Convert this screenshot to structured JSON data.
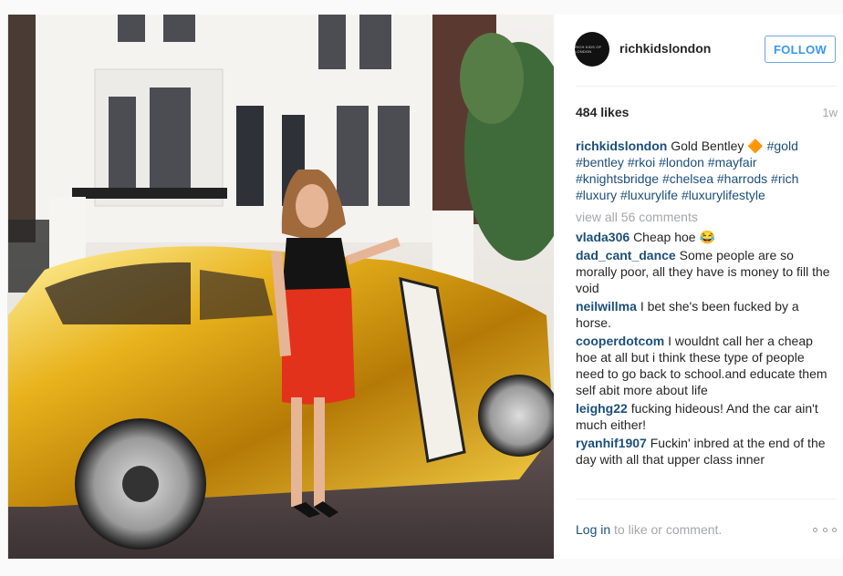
{
  "post": {
    "username": "richkidslondon",
    "avatar_text": "RICH KIDS OF LONDON",
    "follow_label": "FOLLOW",
    "likes": "484 likes",
    "time": "1w",
    "caption": {
      "username": "richkidslondon",
      "text": "Gold Bentley 🔶",
      "tags": [
        "#gold",
        "#bentley",
        "#rkoi",
        "#london",
        "#mayfair",
        "#knightsbridge",
        "#chelsea",
        "#harrods",
        "#rich",
        "#luxury",
        "#luxurylife",
        "#luxurylifestyle"
      ]
    },
    "view_all": "view all 56 comments",
    "comments": [
      {
        "user": "vlada306",
        "text": "Cheap hoe 😂"
      },
      {
        "user": "dad_cant_dance",
        "text": "Some people are so morally poor, all they have is money to fill the void"
      },
      {
        "user": "neilwillma",
        "text": "I bet she's been fucked by a horse."
      },
      {
        "user": "cooperdotcom",
        "text": "I wouldnt call her a cheap hoe at all but i think these type of people need to go back to school.and educate them self abit more about life"
      },
      {
        "user": "leighg22",
        "text": "fucking hideous! And the car ain't much either!"
      },
      {
        "user": "ryanhif1907",
        "text": "Fuckin' inbred at the end of the day with all that upper class inner"
      }
    ],
    "login_link": "Log in",
    "login_rest": " to like or comment.",
    "icons": {
      "more": "more-options-icon"
    }
  }
}
